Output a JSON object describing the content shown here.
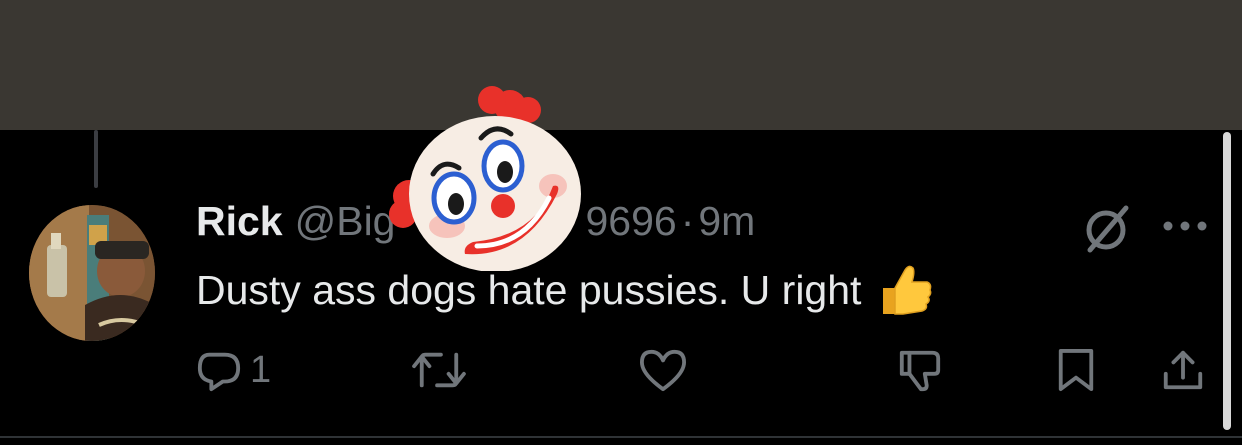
{
  "tweet": {
    "display_name": "Rick",
    "handle_visible": "@Big",
    "handle_suffix_visible": "9696",
    "separator": "·",
    "time": "9m",
    "text_part1": "Dusty ass dogs hate pussies. U right",
    "text_emoji": "thumbs-up-emoji"
  },
  "actions": {
    "reply_count": "1",
    "icons": [
      "reply-icon",
      "retweet-icon",
      "like-icon",
      "dislike-icon",
      "bookmark-icon",
      "share-icon"
    ]
  },
  "overlay": {
    "sticker": "clown-face-emoji"
  },
  "colors": {
    "background": "#000000",
    "top_bar": "#3a3732",
    "text_primary": "#e7e9ea",
    "text_secondary": "#71767b"
  }
}
